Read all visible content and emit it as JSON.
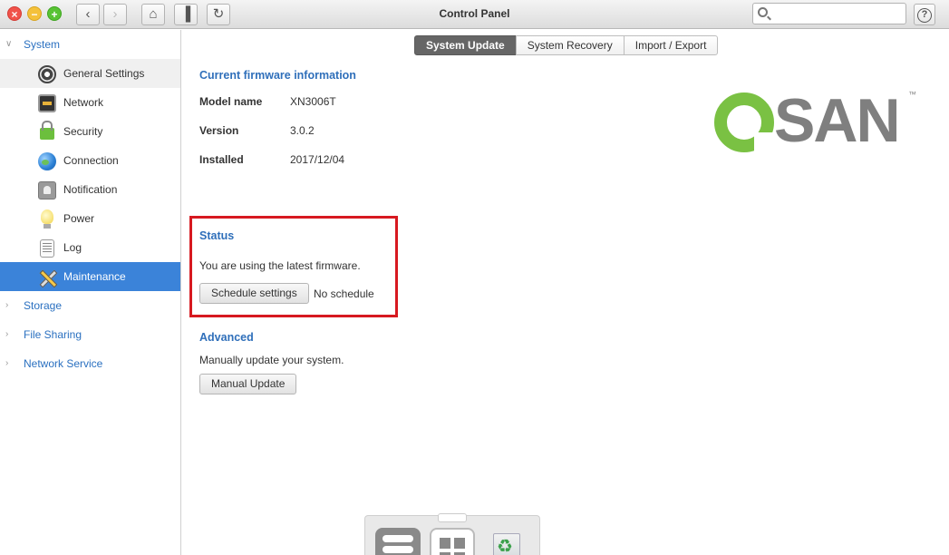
{
  "window": {
    "title": "Control Panel",
    "controls": {
      "close": "×",
      "minimize": "−",
      "maximize": "+"
    },
    "nav": {
      "back": "‹",
      "forward": "›",
      "home": "⌂",
      "layout": "▐",
      "refresh": "↻"
    },
    "search": {
      "placeholder": "",
      "value": ""
    },
    "help": "?"
  },
  "sidebar": {
    "groups": [
      {
        "label": "System",
        "expanded": true,
        "chevron": "∨"
      },
      {
        "label": "Storage",
        "expanded": false,
        "chevron": "›"
      },
      {
        "label": "File Sharing",
        "expanded": false,
        "chevron": "›"
      },
      {
        "label": "Network Service",
        "expanded": false,
        "chevron": "›"
      }
    ],
    "system_items": [
      {
        "label": "General Settings",
        "icon": "gear-icon"
      },
      {
        "label": "Network",
        "icon": "network-icon"
      },
      {
        "label": "Security",
        "icon": "lock-icon"
      },
      {
        "label": "Connection",
        "icon": "globe-icon"
      },
      {
        "label": "Notification",
        "icon": "bell-icon"
      },
      {
        "label": "Power",
        "icon": "bulb-icon"
      },
      {
        "label": "Log",
        "icon": "log-icon"
      },
      {
        "label": "Maintenance",
        "icon": "tools-icon",
        "active": true
      }
    ]
  },
  "tabs": [
    {
      "label": "System Update",
      "active": true
    },
    {
      "label": "System Recovery"
    },
    {
      "label": "Import / Export"
    }
  ],
  "firmware": {
    "heading": "Current firmware information",
    "model_label": "Model name",
    "model_value": "XN3006T",
    "version_label": "Version",
    "version_value": "3.0.2",
    "installed_label": "Installed",
    "installed_value": "2017/12/04"
  },
  "logo": {
    "text": "SAN",
    "tm": "™"
  },
  "status": {
    "heading": "Status",
    "message": "You are using the latest firmware.",
    "schedule_button": "Schedule settings",
    "schedule_value": "No schedule"
  },
  "advanced": {
    "heading": "Advanced",
    "message": "Manually update your system.",
    "manual_button": "Manual Update"
  },
  "colors": {
    "accent": "#3b83d9",
    "link": "#2f6fba",
    "highlight_box": "#d71920",
    "logo_green": "#7ac143",
    "logo_gray": "#7f7f7f"
  }
}
